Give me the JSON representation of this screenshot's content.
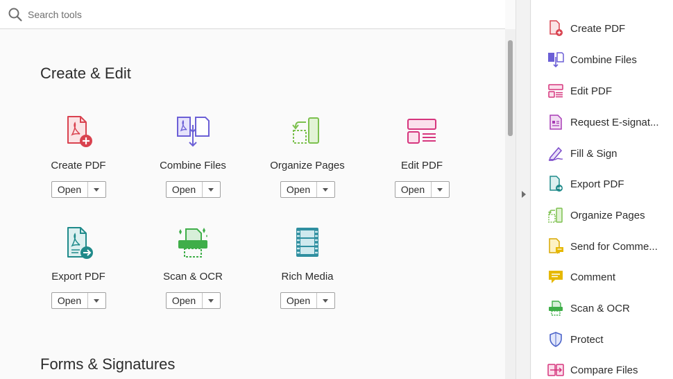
{
  "search": {
    "placeholder": "Search tools"
  },
  "sections": {
    "create_edit": {
      "title": "Create & Edit"
    },
    "forms_signatures": {
      "title": "Forms & Signatures"
    }
  },
  "tools": [
    {
      "name": "Create PDF",
      "icon": "create-pdf-icon",
      "button": "Open",
      "color": "#d9424f"
    },
    {
      "name": "Combine Files",
      "icon": "combine-files-icon",
      "button": "Open",
      "color": "#6b5fd6"
    },
    {
      "name": "Organize Pages",
      "icon": "organize-pages-icon",
      "button": "Open",
      "color": "#7cc04e"
    },
    {
      "name": "Edit PDF",
      "icon": "edit-pdf-icon",
      "button": "Open",
      "color": "#d6357d"
    },
    {
      "name": "Export PDF",
      "icon": "export-pdf-icon",
      "button": "Open",
      "color": "#1f8a8a"
    },
    {
      "name": "Scan & OCR",
      "icon": "scan-ocr-icon",
      "button": "Open",
      "color": "#3fae49"
    },
    {
      "name": "Rich Media",
      "icon": "rich-media-icon",
      "button": "Open",
      "color": "#2f8fa0"
    }
  ],
  "sidebar": {
    "items": [
      {
        "label": "Create PDF",
        "icon": "create-pdf-icon"
      },
      {
        "label": "Combine Files",
        "icon": "combine-files-icon"
      },
      {
        "label": "Edit PDF",
        "icon": "edit-pdf-icon"
      },
      {
        "label": "Request E-signat...",
        "icon": "request-esignature-icon"
      },
      {
        "label": "Fill & Sign",
        "icon": "fill-sign-icon"
      },
      {
        "label": "Export PDF",
        "icon": "export-pdf-icon"
      },
      {
        "label": "Organize Pages",
        "icon": "organize-pages-icon"
      },
      {
        "label": "Send for Comme...",
        "icon": "send-for-comments-icon"
      },
      {
        "label": "Comment",
        "icon": "comment-icon"
      },
      {
        "label": "Scan & OCR",
        "icon": "scan-ocr-icon"
      },
      {
        "label": "Protect",
        "icon": "protect-icon"
      },
      {
        "label": "Compare Files",
        "icon": "compare-files-icon"
      }
    ]
  }
}
